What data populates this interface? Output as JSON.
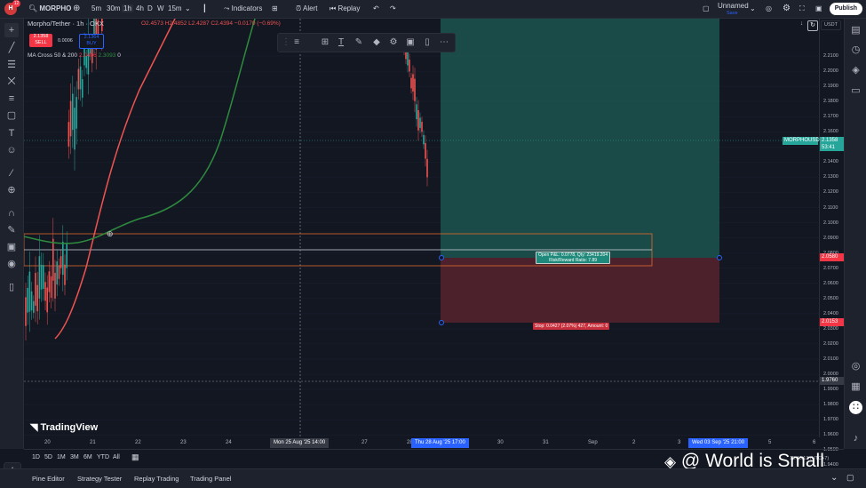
{
  "topbar": {
    "badge": "12",
    "avatar": "H",
    "symbol": "MORPHO",
    "timeframes": [
      "5m",
      "30m",
      "1h",
      "4h",
      "D",
      "W",
      "15m"
    ],
    "indicators": "Indicators",
    "alert": "Alert",
    "replay": "Replay",
    "layout_name": "Unnamed",
    "layout_status": "Save",
    "publish": "Publish"
  },
  "legend": {
    "title": "Morpho/Tether · 1h · OKX",
    "ohlc": "O2.4573 H2.4852 L2.4287 C2.4394 −0.0170 (−0.69%)",
    "sell_price": "2.1358",
    "sell_label": "SELL",
    "spread": "0.0006",
    "buy_price": "2.1364",
    "buy_label": "BUY",
    "indicator_name": "MA Cross 50 & 200",
    "ma_fast": "2.0406",
    "ma_slow": "2.3093",
    "ma_extra": "0"
  },
  "price_axis": {
    "currency": "USDT",
    "ticks": [
      "2.2100",
      "2.2000",
      "2.1900",
      "2.1800",
      "2.1700",
      "2.1600",
      "2.1500",
      "2.1400",
      "2.1300",
      "2.1200",
      "2.1100",
      "2.1000",
      "2.0900",
      "2.0800",
      "2.0700",
      "2.0600",
      "2.0500",
      "2.0400",
      "2.0300",
      "2.0200",
      "2.0100",
      "2.0000",
      "1.9900",
      "1.9800",
      "1.9700",
      "1.9600",
      "1.9500",
      "1.9400"
    ],
    "last_symbol": "MORPHOUSDT",
    "last_price": "2.1358",
    "countdown": "53:41",
    "entry_price": "2.0580",
    "stop_price": "2.0153",
    "crosshair_price": "1.9760"
  },
  "time_axis": {
    "ticks": [
      "20",
      "21",
      "22",
      "23",
      "24",
      "26",
      "27",
      "28",
      "30",
      "31",
      "Sep",
      "2",
      "3",
      "5",
      "6"
    ],
    "crosshair_label": "Mon 25 Aug '25   14:00",
    "start_label": "Thu 28 Aug '25   17:00",
    "end_label": "Wed 03 Sep '25   21:00"
  },
  "position": {
    "open_pnl": "Open P&L: 0.0778, Qty: 23419.204",
    "rr": "Risk/Reward Ratio: 7.89",
    "stop": "Stop: 0.0427 (2.07%) 427, Amount: 0"
  },
  "tv_logo": "TradingView",
  "bottom": {
    "ranges": [
      "1D",
      "5D",
      "1M",
      "3M",
      "6M",
      "YTD",
      "All"
    ],
    "time_readout": "10:46:13 (UTC+7)"
  },
  "panel_tabs": [
    "Pine Editor",
    "Strategy Tester",
    "Replay Trading",
    "Trading Panel"
  ],
  "watermark": "@ World is Small",
  "colors": {
    "background": "#131722",
    "bullish": "#26a69a",
    "bearish": "#ef5350",
    "ma_fast": "#f23645",
    "ma_slow": "#2e8b3e",
    "target_zone": "#1f5e56",
    "stop_zone": "#5b2430",
    "accent": "#2962ff"
  },
  "icons": {
    "top": [
      "search-icon",
      "plus-icon",
      "chevron-down-icon",
      "candles-icon",
      "indicators-icon",
      "layout-grid-icon",
      "alert-icon",
      "replay-icon",
      "undo-icon",
      "redo-icon",
      "layout-icon",
      "gear-icon",
      "camera-icon",
      "fullscreen-icon"
    ],
    "left": [
      "crosshair-icon",
      "trend-line-icon",
      "fib-icon",
      "pattern-icon",
      "projection-icon",
      "shapes-icon",
      "text-icon",
      "emoji-icon",
      "ruler-icon",
      "zoom-icon",
      "magnet-icon",
      "pencil-lock-icon",
      "lock-icon",
      "eye-icon",
      "trash-icon",
      "star-icon"
    ],
    "right": [
      "watchlist-icon",
      "alerts-clock-icon",
      "layers-icon",
      "chat-icon",
      "target-icon",
      "calendar-icon",
      "apps-icon",
      "bell-icon"
    ]
  }
}
